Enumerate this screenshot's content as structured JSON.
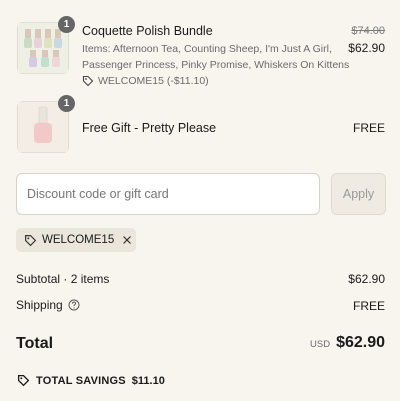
{
  "items": [
    {
      "quantity": "1",
      "name": "Coquette Polish Bundle",
      "description": "Items: Afternoon Tea, Counting Sheep, I'm Just A Girl, Passenger Princess, Pinky Promise, Whiskers On Kittens",
      "discount": "WELCOME15 (-$11.10)",
      "compare_price": "$74.00",
      "price": "$62.90"
    },
    {
      "quantity": "1",
      "name": "Free Gift - Pretty Please",
      "price": "FREE"
    }
  ],
  "discount_input": {
    "placeholder": "Discount code or gift card"
  },
  "apply_button": {
    "label": "Apply"
  },
  "applied_code": {
    "code": "WELCOME15"
  },
  "summary": {
    "subtotal_label": "Subtotal · 2 items",
    "subtotal_value": "$62.90",
    "shipping_label": "Shipping",
    "shipping_value": "FREE",
    "total_label": "Total",
    "currency": "USD",
    "total_value": "$62.90",
    "savings_label": "TOTAL SAVINGS",
    "savings_value": "$11.10"
  },
  "colors": {
    "background": "#f8f5ef",
    "chip_background": "#ebe6db",
    "badge": "#666666"
  }
}
